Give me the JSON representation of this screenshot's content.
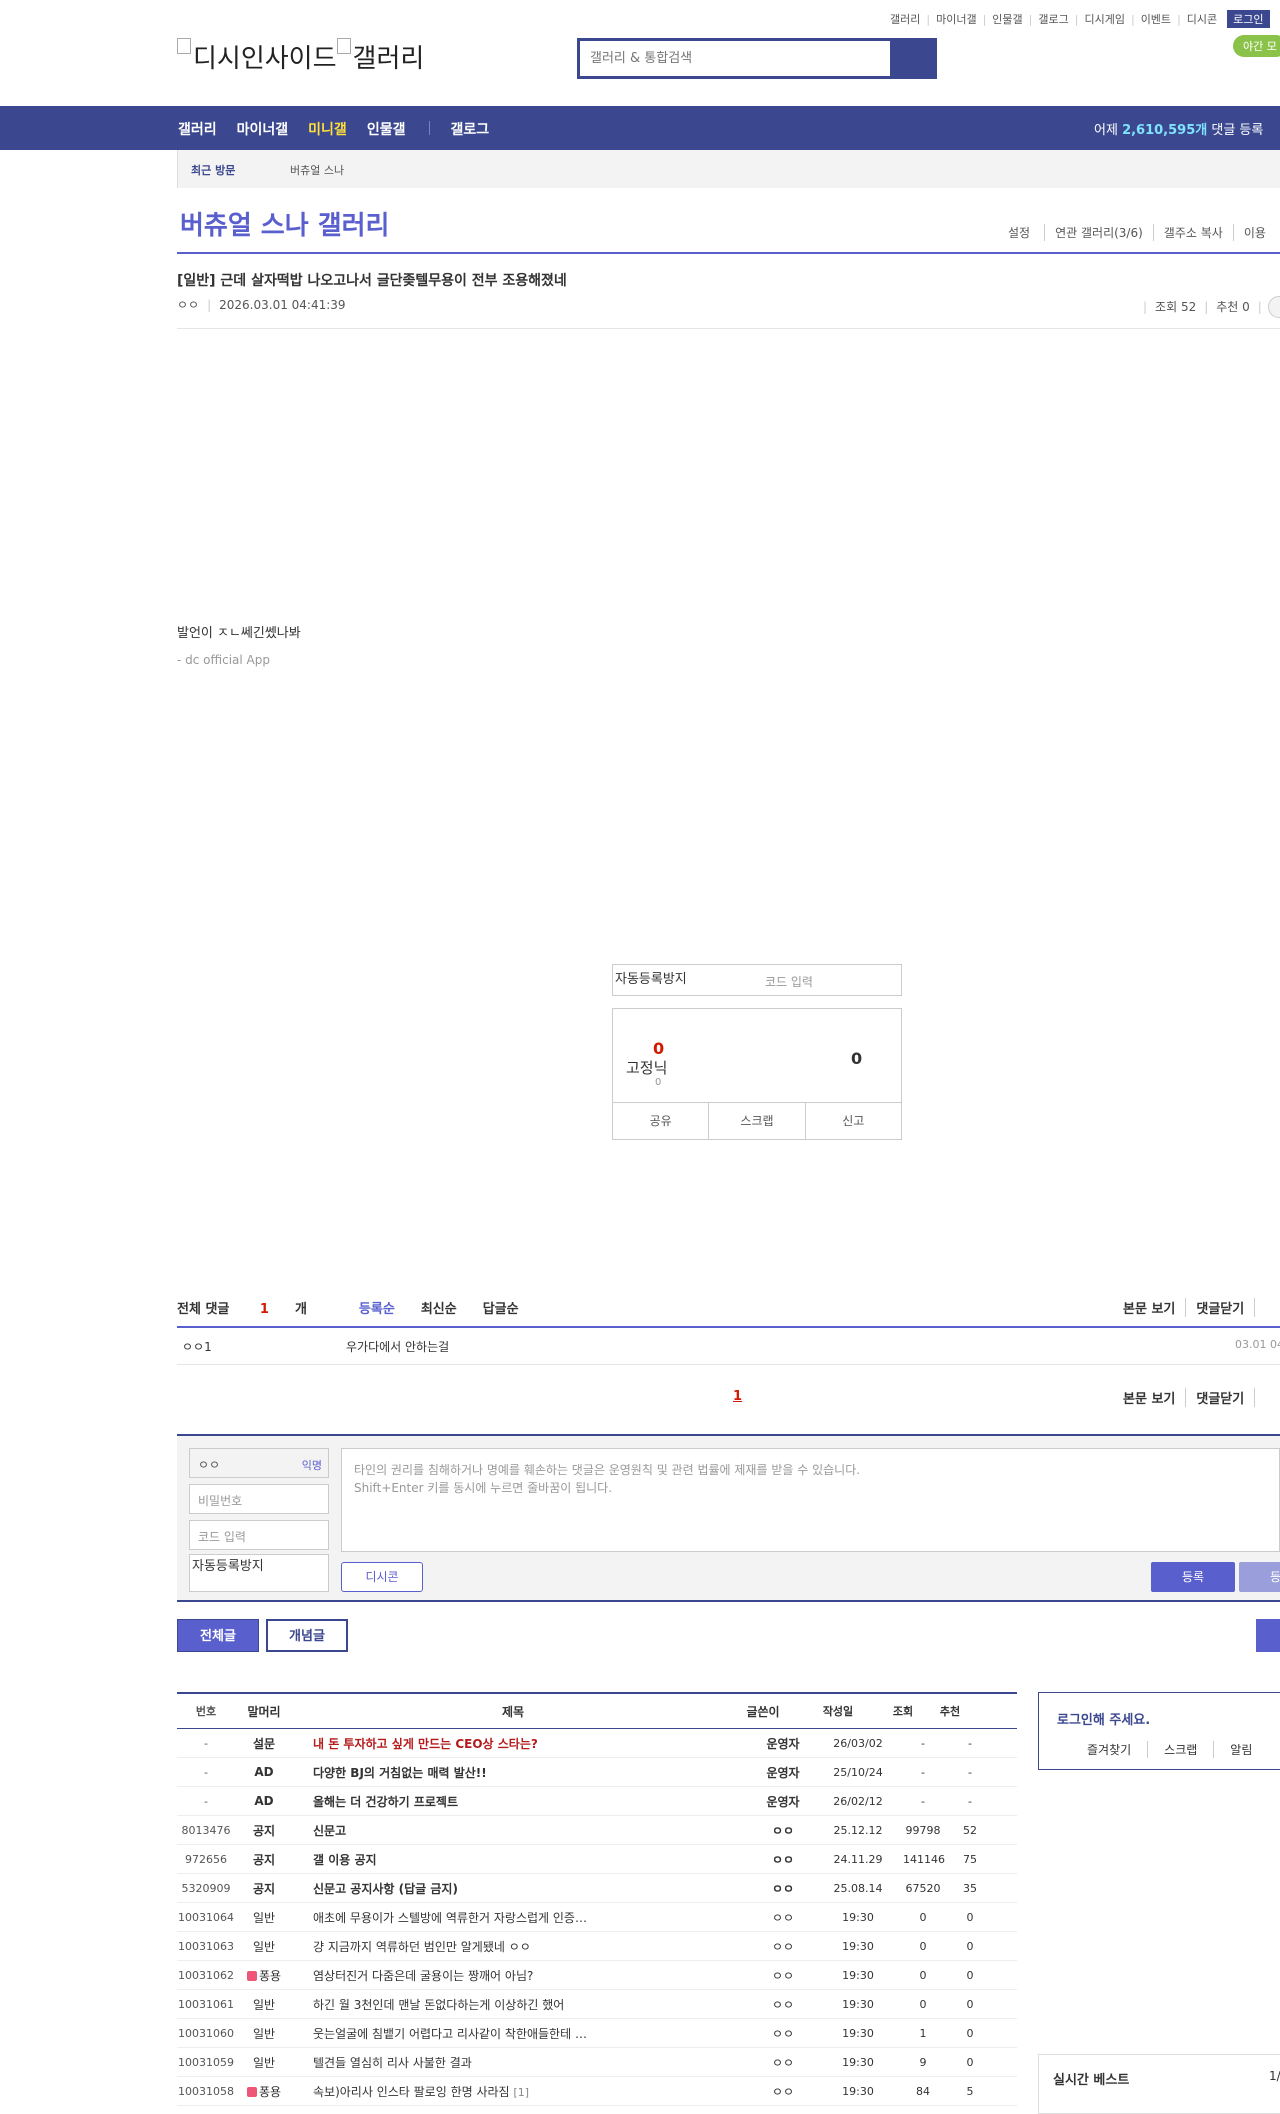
{
  "util_links": [
    "갤러리",
    "마이너갤",
    "인물갤",
    "갤로그",
    "디시게임",
    "이벤트",
    "디시콘"
  ],
  "login_label": "로그인",
  "night_label": "야간 모",
  "logo": {
    "img1": "디시인사이드",
    "img2": "갤러리"
  },
  "search": {
    "placeholder": "갤러리 & 통합검색"
  },
  "nav": {
    "items": [
      "갤러리",
      "마이너갤",
      "미니갤",
      "인물갤"
    ],
    "gallog": "갤로그",
    "stat_prefix": "어제",
    "stat_value": "2,610,595개",
    "stat_suffix": "댓글 등록"
  },
  "recent": {
    "label": "최근 방문",
    "item": "버츄얼 스나"
  },
  "gallery": {
    "title": "버츄얼 스나 갤러리",
    "tools": [
      "설정",
      "연관 갤러리(3/6)",
      "갤주소 복사",
      "이용"
    ]
  },
  "post": {
    "title": "[일반] 근데 살자떡밥 나오고나서 글단좆텔무용이 전부 조용해졌네",
    "author": "ㅇㅇ",
    "date": "2026.03.01 04:41:39",
    "views": "조회 52",
    "recommend": "추천 0",
    "body": "발언이 ㅈㄴ쎄긴쎘나봐",
    "app": "- dc official App"
  },
  "captcha": {
    "img_alt": "자동등록방지",
    "code_placeholder": "코드 입력"
  },
  "recommend_box": {
    "up": "0",
    "fix_alt": "고정닉",
    "fix_count": "0",
    "down": "0",
    "buttons": [
      "공유",
      "스크랩",
      "신고"
    ]
  },
  "comments": {
    "total_label": "전체 댓글",
    "total_count": "1",
    "total_unit": "개",
    "sort": [
      "등록순",
      "최신순",
      "답글순"
    ],
    "right": [
      "본문 보기",
      "댓글닫기"
    ],
    "items": [
      {
        "writer": "ㅇㅇ1",
        "text": "우가다에서 안하는걸",
        "date": "03.01 04"
      }
    ],
    "page": "1"
  },
  "write": {
    "nick": "ㅇㅇ",
    "anon": "익명",
    "password": "비밀번호",
    "code": "코드 입력",
    "img_alt": "자동등록방지",
    "notice1": "타인의 권리를 침해하거나 명예를 훼손하는 댓글은 운영원칙 및 관련 법률에 제재를 받을 수 있습니다.",
    "notice2": "Shift+Enter 키를 동시에 누르면 줄바꿈이 됩니다.",
    "dccon": "디시콘",
    "submit": "등록",
    "submit2": "등록"
  },
  "tabs": {
    "all": "전체글",
    "best": "개념글"
  },
  "list": {
    "headers": [
      "번호",
      "말머리",
      "제목",
      "글쓴이",
      "작성일",
      "조회",
      "추천"
    ],
    "rows": [
      {
        "no": "-",
        "head": "설문",
        "title": "내 돈 투자하고 싶게 만드는 CEO상 스타는?",
        "writer": "운영자",
        "date": "26/03/02",
        "views": "-",
        "rec": "-"
      },
      {
        "no": "-",
        "head": "AD",
        "title": "다양한 BJ의 거침없는 매력 발산!!",
        "writer": "운영자",
        "date": "25/10/24",
        "views": "-",
        "rec": "-"
      },
      {
        "no": "-",
        "head": "AD",
        "title": "올해는 더 건강하기 프로젝트",
        "writer": "운영자",
        "date": "26/02/12",
        "views": "-",
        "rec": "-"
      },
      {
        "no": "8013476",
        "head": "공지",
        "title": "신문고",
        "writer": "ㅇㅇ",
        "date": "25.12.12",
        "views": "99798",
        "rec": "52"
      },
      {
        "no": "972656",
        "head": "공지",
        "title": "갤 이용 공지",
        "writer": "ㅇㅇ",
        "date": "24.11.29",
        "views": "141146",
        "rec": "75"
      },
      {
        "no": "5320909",
        "head": "공지",
        "title": "신문고 공지사항 (답글 금지)",
        "writer": "ㅇㅇ",
        "date": "25.08.14",
        "views": "67520",
        "rec": "35"
      },
      {
        "no": "10031064",
        "head": "일반",
        "title": "애초에 무용이가 스텔방에 역류한거 자랑스럽게 인증…",
        "writer": "ㅇㅇ",
        "date": "19:30",
        "views": "0",
        "rec": "0"
      },
      {
        "no": "10031063",
        "head": "일반",
        "title": "걍 지금까지 역류하던 범인만 알게됐네 ㅇㅇ",
        "writer": "ㅇㅇ",
        "date": "19:30",
        "views": "0",
        "rec": "0"
      },
      {
        "no": "10031062",
        "head": "퐁용",
        "title": "염상터진거 다줌은데 굴용이는 짱깨어 아님?",
        "writer": "ㅇㅇ",
        "date": "19:30",
        "views": "0",
        "rec": "0"
      },
      {
        "no": "10031061",
        "head": "일반",
        "title": "하긴 월 3천인데 맨날 돈없다하는게 이상하긴 했어",
        "writer": "ㅇㅇ",
        "date": "19:30",
        "views": "0",
        "rec": "0"
      },
      {
        "no": "10031060",
        "head": "일반",
        "title": "웃는얼굴에 침뱉기 어렵다고 리사같이 착한애들한테 …",
        "writer": "ㅇㅇ",
        "date": "19:30",
        "views": "1",
        "rec": "0"
      },
      {
        "no": "10031059",
        "head": "일반",
        "title": "텔견들 열심히 리사 사불한 결과",
        "writer": "ㅇㅇ",
        "date": "19:30",
        "views": "9",
        "rec": "0"
      },
      {
        "no": "10031058",
        "head": "퐁용",
        "title": "속보)아리사 인스타 팔로잉 한명 사라짐",
        "reply": "[1]",
        "writer": "ㅇㅇ",
        "date": "19:30",
        "views": "84",
        "rec": "5"
      }
    ]
  },
  "side": {
    "login_title": "로그인해 주세요.",
    "links": [
      "즐겨찾기",
      "스크랩",
      "알림"
    ],
    "best_title": "실시간 베스트",
    "best_page": "1/"
  }
}
